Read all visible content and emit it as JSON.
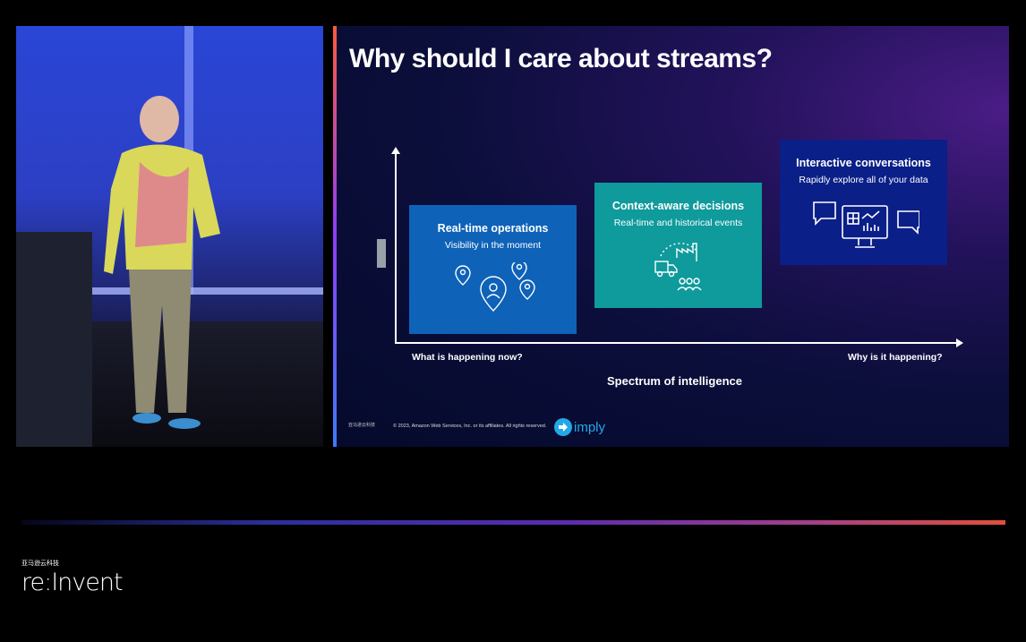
{
  "slide": {
    "title": "Why should I care about streams?",
    "cards": [
      {
        "title": "Real-time operations",
        "subtitle": "Visibility in the moment"
      },
      {
        "title": "Context-aware decisions",
        "subtitle": "Real-time and historical events"
      },
      {
        "title": "Interactive conversations",
        "subtitle": "Rapidly explore all of your data"
      }
    ],
    "axis": {
      "left_label": "What is happening now?",
      "right_label": "Why is it happening?",
      "title": "Spectrum of intelligence"
    },
    "footer": {
      "small_logo": "亚马逊云科技",
      "copyright": "© 2023, Amazon Web Services, Inc. or its affiliates. All rights reserved.",
      "partner": "imply"
    }
  },
  "event": {
    "cn_text": "亚马逊云科技",
    "name": "re:Invent"
  },
  "colors": {
    "card_realtime": "#0e62b8",
    "card_context": "#0f9a9c",
    "card_interactive": "#0a1f88",
    "partner_brand": "#22a9e6"
  }
}
